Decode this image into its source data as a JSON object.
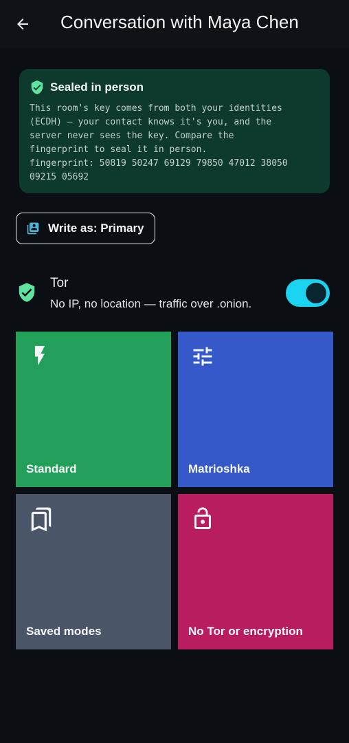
{
  "header": {
    "title": "Conversation with Maya Chen",
    "back_icon": "arrow-left-icon"
  },
  "seal": {
    "title": "Sealed in person",
    "icon": "shield-check-icon",
    "body": "This room's key comes from both your identities\n(ECDH) — your contact knows it's you, and the\nserver never sees the key. Compare the\nfingerprint to seal it in person.\nfingerprint: 50819 50247 69129 79850 47012 38050\n09215 05692"
  },
  "write_as": {
    "label": "Write as: Primary",
    "icon": "identity-book-icon"
  },
  "tor": {
    "title": "Tor",
    "subtitle": "No IP, no location — traffic over .onion.",
    "enabled": true,
    "icon": "shield-check-icon"
  },
  "modes": [
    {
      "label": "Standard",
      "icon": "lightning-icon",
      "color": "#22a05a"
    },
    {
      "label": "Matrioshka",
      "icon": "sliders-icon",
      "color": "#3559c9"
    },
    {
      "label": "Saved modes",
      "icon": "bookmarks-icon",
      "color": "#4a5567"
    },
    {
      "label": "No Tor or encryption",
      "icon": "unlock-icon",
      "color": "#b81e5f"
    }
  ],
  "colors": {
    "accent_toggle": "#19d3f0",
    "shield_green": "#5fe3a1",
    "seal_card_bg": "#0e3a2d"
  }
}
